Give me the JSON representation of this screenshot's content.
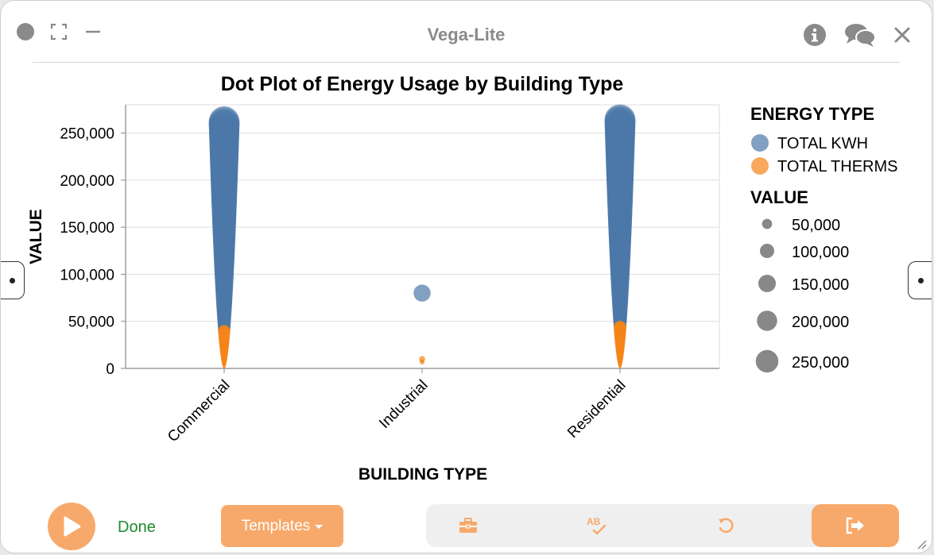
{
  "window": {
    "title": "Vega-Lite"
  },
  "bottom": {
    "status": "Done",
    "templates_label": "Templates"
  },
  "colors": {
    "accent": "#f7a96b",
    "kwh": "#4c78a8",
    "therms": "#f58518",
    "done": "#1f8a2c"
  },
  "chart_data": {
    "type": "scatter",
    "title": "Dot Plot of Energy Usage by Building Type",
    "xlabel": "BUILDING TYPE",
    "ylabel": "VALUE",
    "categories": [
      "Commercial",
      "Industrial",
      "Residential"
    ],
    "ylim": [
      0,
      280000
    ],
    "yticks": [
      0,
      50000,
      100000,
      150000,
      200000,
      250000
    ],
    "grid": true,
    "legend_position": "right",
    "color_legend_title": "ENERGY TYPE",
    "size_legend_title": "VALUE",
    "size_legend_values": [
      50000,
      100000,
      150000,
      200000,
      250000
    ],
    "series": [
      {
        "name": "TOTAL KWH",
        "color": "#4c78a8",
        "points": [
          {
            "category": "Commercial",
            "range": [
              40000,
              262000
            ],
            "step": 2000
          },
          {
            "category": "Industrial",
            "values": [
              80000
            ]
          },
          {
            "category": "Residential",
            "range": [
              42000,
              264000
            ],
            "step": 2000
          }
        ]
      },
      {
        "name": "TOTAL THERMS",
        "color": "#f58518",
        "points": [
          {
            "category": "Commercial",
            "range": [
              0,
              40000
            ],
            "step": 1000
          },
          {
            "category": "Industrial",
            "values": [
              7000,
              10000
            ]
          },
          {
            "category": "Residential",
            "range": [
              0,
              44000
            ],
            "step": 1000
          }
        ]
      }
    ]
  }
}
